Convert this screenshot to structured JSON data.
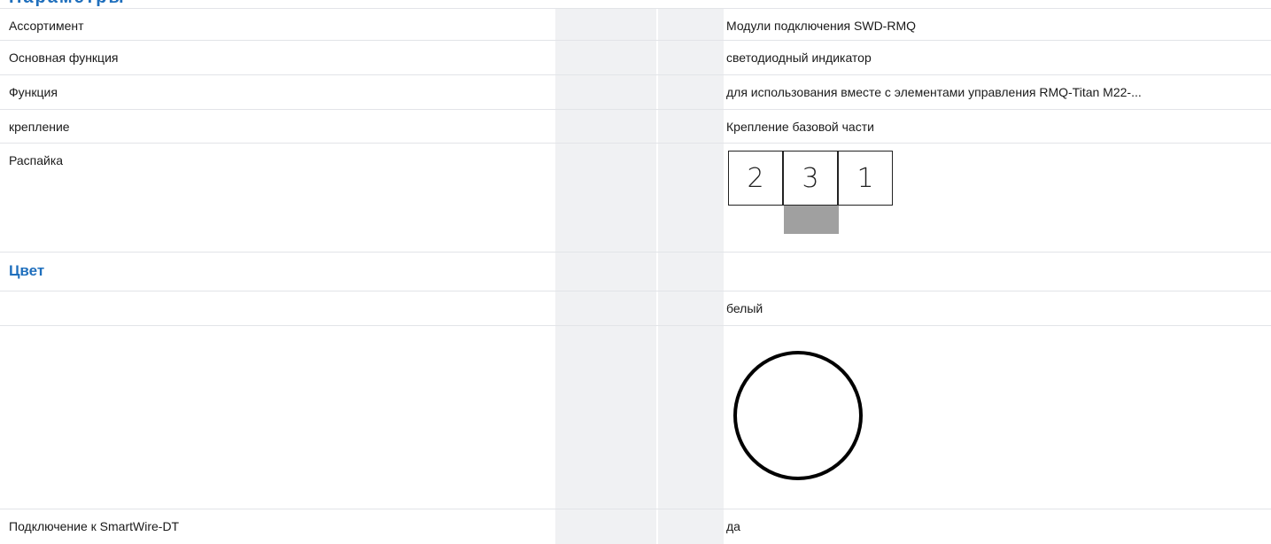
{
  "section_top": {
    "title": "Параметры"
  },
  "rows": {
    "assortment": {
      "label": "Ассортимент",
      "value": "Модули подключения SWD-RMQ"
    },
    "main_function": {
      "label": "Основная функция",
      "value": "светодиодный индикатор"
    },
    "function": {
      "label": "Функция",
      "value": "для использования вместе с элементами управления RMQ-Titan M22-..."
    },
    "mounting": {
      "label": "крепление",
      "value": "Крепление базовой части"
    },
    "pinout": {
      "label": "Распайка",
      "pins": [
        "2",
        "3",
        "1"
      ]
    }
  },
  "color_section": {
    "title": "Цвет",
    "color_value": "белый",
    "swatch_color": "#ffffff",
    "swatch_stroke": "#000000"
  },
  "smartwire": {
    "label": "Подключение к SmartWire-DT",
    "value": "да"
  },
  "colors": {
    "accent": "#1f6fbd",
    "shade": "#f0f1f3",
    "divider": "#e2e4e8",
    "tab": "#a0a0a0"
  }
}
